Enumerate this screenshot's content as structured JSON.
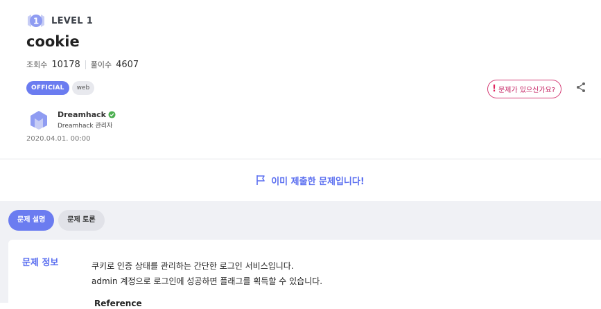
{
  "challenge": {
    "level_number": "1",
    "level_label": "LEVEL 1",
    "title": "cookie",
    "views_label": "조회수",
    "views_value": "10178",
    "solves_label": "풀이수",
    "solves_value": "4607",
    "tags": [
      "OFFICIAL",
      "web"
    ],
    "report_label": "문제가 있으신가요?",
    "date": "2020.04.01. 00:00"
  },
  "author": {
    "name": "Dreamhack",
    "role": "Dreamhack 관리자"
  },
  "status": {
    "submitted_message": "이미 제출한 문제입니다!"
  },
  "tabs": [
    {
      "label": "문제 설명",
      "active": true
    },
    {
      "label": "문제 토론",
      "active": false
    }
  ],
  "info": {
    "heading": "문제 정보",
    "lines": [
      "쿠키로 인증 상태를 관리하는 간단한 로그인 서비스입니다.",
      "admin 계정으로 로그인에 성공하면 플래그를 획득할 수 있습니다."
    ],
    "reference_label": "Reference"
  },
  "icons": {
    "level": "level-badge-icon",
    "share": "share-icon",
    "flag": "flag-icon",
    "verified": "verified-check-icon",
    "report": "exclamation-icon"
  },
  "colors": {
    "accent": "#6b7cf0",
    "report": "#d43a73",
    "verified": "#4caf50"
  }
}
